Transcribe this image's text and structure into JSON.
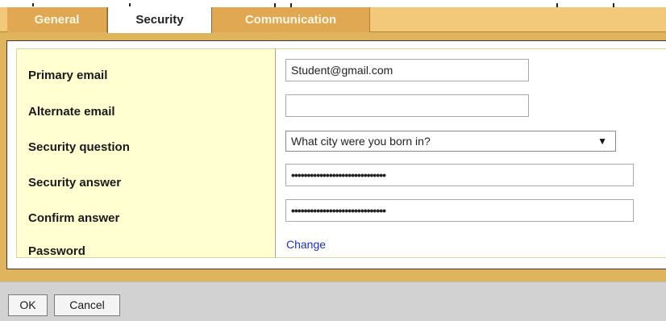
{
  "tabs": [
    {
      "label": "General"
    },
    {
      "label": "Security"
    },
    {
      "label": "Communication"
    }
  ],
  "active_tab": "Security",
  "form": {
    "primary_email_label": "Primary email",
    "primary_email_value": "Student@gmail.com",
    "alternate_email_label": "Alternate email",
    "alternate_email_value": "",
    "security_question_label": "Security question",
    "security_question_value": "What city were you born in?",
    "security_answer_label": "Security answer",
    "security_answer_value": "••••••••••••••••••••••••••••••",
    "confirm_answer_label": "Confirm answer",
    "confirm_answer_value": "••••••••••••••••••••••••••••••",
    "password_label": "Password",
    "password_link": "Change"
  },
  "buttons": {
    "ok": "OK",
    "cancel": "Cancel"
  },
  "icons": {
    "dropdown": "dropdown-arrow-icon"
  },
  "colors": {
    "tab_bar": "#f2c97b",
    "tab": "#e0a852",
    "panel_border": "#e0b35d",
    "label_column": "#ffffd2",
    "link": "#1b2fd1",
    "footer": "#d2d2d2"
  }
}
